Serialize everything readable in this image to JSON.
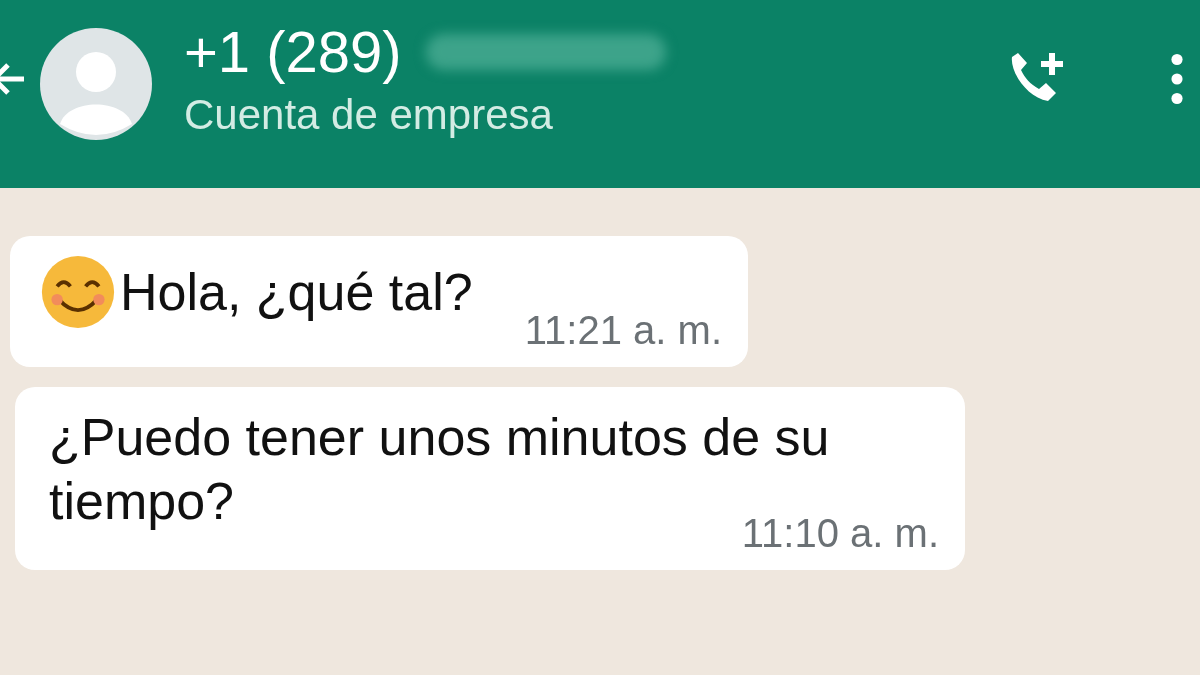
{
  "header": {
    "title": "+1 (289)",
    "subtitle": "Cuenta de empresa"
  },
  "messages": [
    {
      "has_emoji": true,
      "text": "Hola, ¿qué tal?",
      "time": "11:21 a. m."
    },
    {
      "has_emoji": false,
      "text": "¿Puedo tener unos minutos de su tiempo?",
      "time": "11:10 a. m."
    }
  ]
}
